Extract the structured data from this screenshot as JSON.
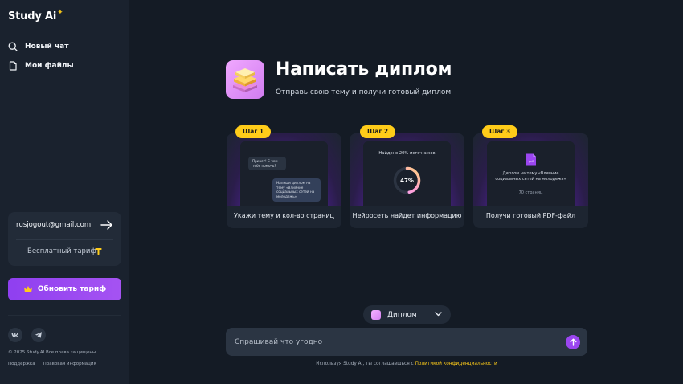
{
  "sidebar": {
    "logo": "Study",
    "logo_ai": "Ai",
    "nav": [
      {
        "label": "Новый чат",
        "icon": "search-icon"
      },
      {
        "label": "Мои файлы",
        "icon": "file-icon"
      }
    ],
    "account": {
      "email": "rusjogout@gmail.com",
      "plan": "Бесплатный тариф"
    },
    "upgrade_label": "Обновить тариф",
    "social": [
      "vk-icon",
      "telegram-icon"
    ],
    "copyright": "© 2025 Study.AI Все права защищены",
    "links": [
      "Поддержка",
      "Правовая информация"
    ]
  },
  "hero": {
    "title": "Написать диплом",
    "subtitle": "Отправь свою тему и получи готовый диплом"
  },
  "steps": [
    {
      "badge": "Шаг 1",
      "caption": "Укажи тему и кол-во страниц",
      "bubble_1": "Привет! С чем тебе помочь?",
      "bubble_2": "Напиши диплом на тему «Влияние социальных сетей на молодежь»"
    },
    {
      "badge": "Шаг 2",
      "caption": "Нейросеть найдет информацию",
      "found": "Найдено 20% источников",
      "progress_label": "47%",
      "progress": 0.47
    },
    {
      "badge": "Шаг 3",
      "caption": "Получи готовый PDF-файл",
      "pdf_badge": "pdf",
      "pdf_title": "Диплом на тему «Влияние социальных сетей на молодежь»",
      "pdf_pages": "70 страниц"
    }
  ],
  "composer": {
    "mode": "Диплом",
    "placeholder": "Спрашивай что угодно",
    "disclaimer_prefix": "Используя Study AI, ты соглашаешься с ",
    "disclaimer_link": "Политикой конфиденциальности"
  },
  "colors": {
    "accent": "#9b46f0",
    "badge": "#ffcc19",
    "background": "#141b25",
    "sidebar": "#1a222e"
  }
}
